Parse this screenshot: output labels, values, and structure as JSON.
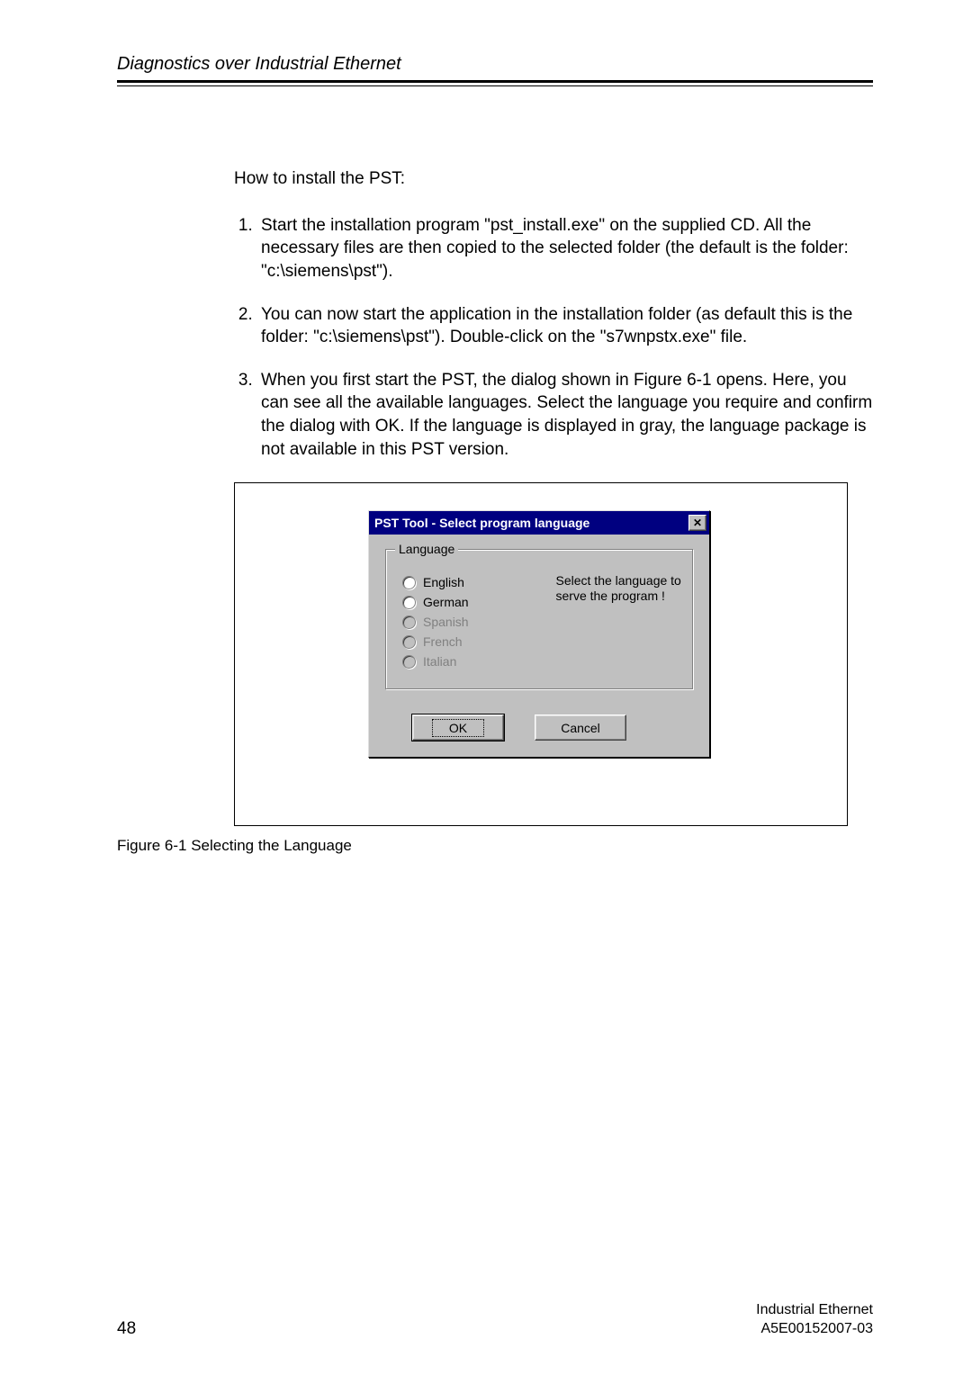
{
  "header": {
    "title": "Diagnostics over Industrial Ethernet"
  },
  "intro": "How to install the PST:",
  "steps": [
    "Start the installation program \"pst_install.exe\" on the supplied CD. All the necessary files are then copied to the selected folder (the default is the folder: \"c:\\siemens\\pst\").",
    "You can now start the application in the installation folder (as default this is the folder: \"c:\\siemens\\pst\"). Double-click on the \"s7wnpstx.exe\" file.",
    "When you first start the PST, the dialog shown in Figure 6-1 opens. Here, you can see all the available languages. Select the language you require and confirm the dialog with OK. If the language is displayed in gray, the language package is not available in this PST version."
  ],
  "dialog": {
    "title": "PST Tool -  Select program language",
    "close_glyph": "✕",
    "group_label": "Language",
    "languages": {
      "english": "English",
      "german": "German",
      "spanish": "Spanish",
      "french": "French",
      "italian": "Italian"
    },
    "hint": "Select the language to serve the program !",
    "ok_label": "OK",
    "cancel_label": "Cancel"
  },
  "caption": "Figure 6-1 Selecting the Language",
  "footer": {
    "page": "48",
    "line1": "Industrial Ethernet",
    "line2": "A5E00152007-03"
  }
}
